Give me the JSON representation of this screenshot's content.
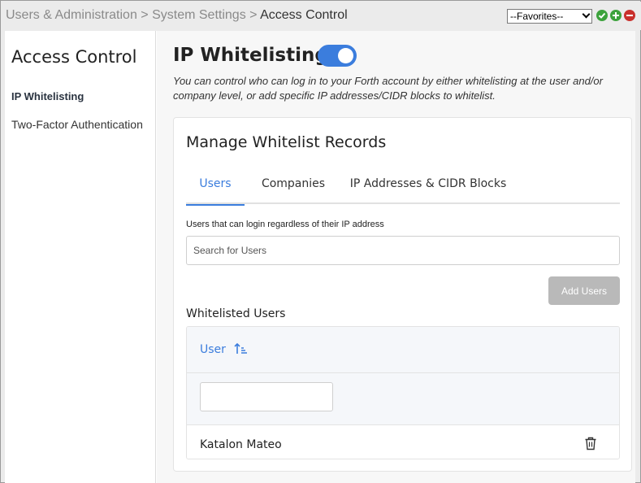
{
  "breadcrumb": {
    "part1": "Users & Administration",
    "sep1": ">",
    "part2": "System Settings",
    "sep2": ">",
    "current": "Access Control"
  },
  "favorites": {
    "selected": "--Favorites--"
  },
  "toolbar_icons": [
    "check-icon",
    "add-icon",
    "remove-icon"
  ],
  "sidebar": {
    "title": "Access Control",
    "items": [
      {
        "label": "IP Whitelisting",
        "active": true
      },
      {
        "label": "Two-Factor Authentication",
        "active": false
      }
    ]
  },
  "main": {
    "title": "IP Whitelisting",
    "toggle_on": true,
    "description": "You can control who can log in to your Forth account by either whitelisting at the user and/or company level, or add specific IP addresses/CIDR blocks to whitelist.",
    "card": {
      "title": "Manage Whitelist Records",
      "tabs": [
        {
          "label": "Users",
          "active": true
        },
        {
          "label": "Companies",
          "active": false
        },
        {
          "label": "IP Addresses & CIDR Blocks",
          "active": false
        }
      ],
      "field_label": "Users that can login regardless of their IP address",
      "search_placeholder": "Search for Users",
      "add_button": "Add Users",
      "section_title": "Whitelisted Users",
      "table": {
        "column": "User",
        "filter_value": "",
        "rows": [
          {
            "user": "Katalon Mateo"
          }
        ]
      }
    }
  },
  "colors": {
    "accent": "#3b7ddd",
    "disabled_button": "#b9b9b9",
    "ok_green": "#3ca23c",
    "remove_red": "#c9302c"
  }
}
